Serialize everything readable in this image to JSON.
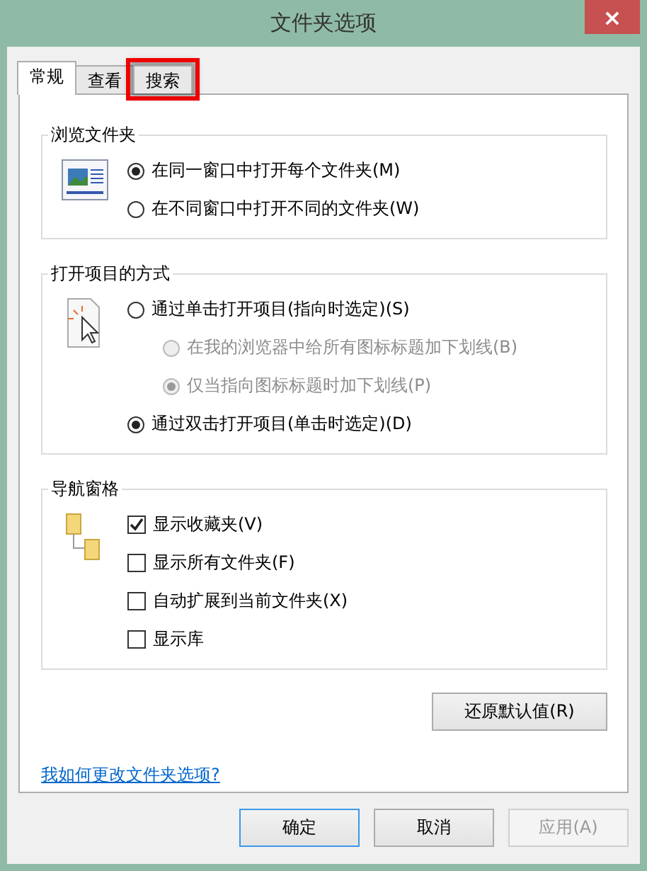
{
  "window": {
    "title": "文件夹选项",
    "close": "×"
  },
  "tabs": [
    {
      "label": "常规",
      "selected": true,
      "highlighted": false
    },
    {
      "label": "查看",
      "selected": false,
      "highlighted": false
    },
    {
      "label": "搜索",
      "selected": false,
      "highlighted": true
    }
  ],
  "groups": [
    {
      "title": "浏览文件夹",
      "options": [
        {
          "kind": "radio",
          "label": "在同一窗口中打开每个文件夹(M)",
          "selected": true,
          "disabled": false
        },
        {
          "kind": "radio",
          "label": "在不同窗口中打开不同的文件夹(W)",
          "selected": false,
          "disabled": false
        }
      ]
    },
    {
      "title": "打开项目的方式",
      "options": [
        {
          "kind": "radio",
          "label": "通过单击打开项目(指向时选定)(S)",
          "selected": false,
          "disabled": false,
          "children": [
            {
              "kind": "radio",
              "label": "在我的浏览器中给所有图标标题加下划线(B)",
              "selected": false,
              "disabled": true
            },
            {
              "kind": "radio",
              "label": "仅当指向图标标题时加下划线(P)",
              "selected": true,
              "disabled": true
            }
          ]
        },
        {
          "kind": "radio",
          "label": "通过双击打开项目(单击时选定)(D)",
          "selected": true,
          "disabled": false
        }
      ]
    },
    {
      "title": "导航窗格",
      "options": [
        {
          "kind": "checkbox",
          "label": "显示收藏夹(V)",
          "checked": true,
          "disabled": false
        },
        {
          "kind": "checkbox",
          "label": "显示所有文件夹(F)",
          "checked": false,
          "disabled": false
        },
        {
          "kind": "checkbox",
          "label": "自动扩展到当前文件夹(X)",
          "checked": false,
          "disabled": false
        },
        {
          "kind": "checkbox",
          "label": "显示库",
          "checked": false,
          "disabled": false
        }
      ]
    }
  ],
  "restore_button": "还原默认值(R)",
  "help_link": "我如何更改文件夹选项?",
  "buttons": [
    {
      "label": "确定",
      "default": true,
      "disabled": false
    },
    {
      "label": "取消",
      "default": false,
      "disabled": false
    },
    {
      "label": "应用(A)",
      "default": false,
      "disabled": true
    }
  ]
}
